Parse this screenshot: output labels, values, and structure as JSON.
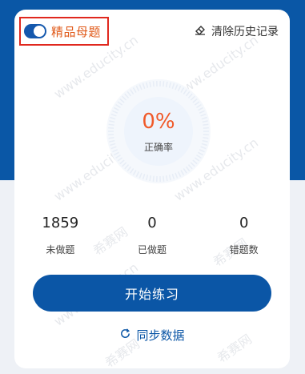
{
  "toggle": {
    "label": "精品母题",
    "on": true
  },
  "header": {
    "clear_history_label": "清除历史记录",
    "clear_icon": "eraser-icon"
  },
  "accuracy": {
    "value": "0%",
    "label": "正确率"
  },
  "stats": [
    {
      "value": "1859",
      "label": "未做题"
    },
    {
      "value": "0",
      "label": "已做题"
    },
    {
      "value": "0",
      "label": "错题数"
    }
  ],
  "actions": {
    "start_label": "开始练习",
    "sync_label": "同步数据",
    "sync_icon": "refresh-icon"
  },
  "watermark": {
    "text_1": "www.educity.cn",
    "text_2": "希赛网"
  },
  "colors": {
    "brand_blue": "#0b56a6",
    "accent_orange": "#f05a2a",
    "highlight_red": "#e0281e",
    "background_gray": "#eef1f6"
  }
}
